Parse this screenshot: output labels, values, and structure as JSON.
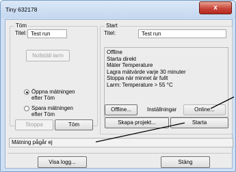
{
  "window": {
    "title": "Tiny 632178",
    "close_label": "x"
  },
  "tom": {
    "legend": "Töm",
    "title_label": "Titel:",
    "title_value": "Test run",
    "reset_alarm_label": "Nollställ larm",
    "radio_open": {
      "line1": "Öppna mätningen",
      "line2": "efter Töm",
      "selected": true
    },
    "radio_save": {
      "line1": "Spara mätningen",
      "line2": "efter Töm",
      "selected": false
    },
    "stop_label": "Stoppa",
    "empty_label": "Töm"
  },
  "start": {
    "legend": "Start",
    "title_label": "Titel:",
    "title_value": "Test run",
    "info_lines": [
      "Offline",
      "Starta direkt",
      "Mäter Temperature",
      "Lagra mätvärde varje 30 minuter",
      "Stoppa när minnet är fullt",
      "Larm: Temperature > 55 °C"
    ],
    "offline_label": "Offline...",
    "settings_label": "Inställningar",
    "online_label": "Online...",
    "create_project_label": "Skapa projekt...",
    "start_label": "Starta"
  },
  "status": {
    "text": "Mätning pågår ej"
  },
  "footer": {
    "show_log_label": "Visa logg...",
    "close_label": "Stäng"
  }
}
